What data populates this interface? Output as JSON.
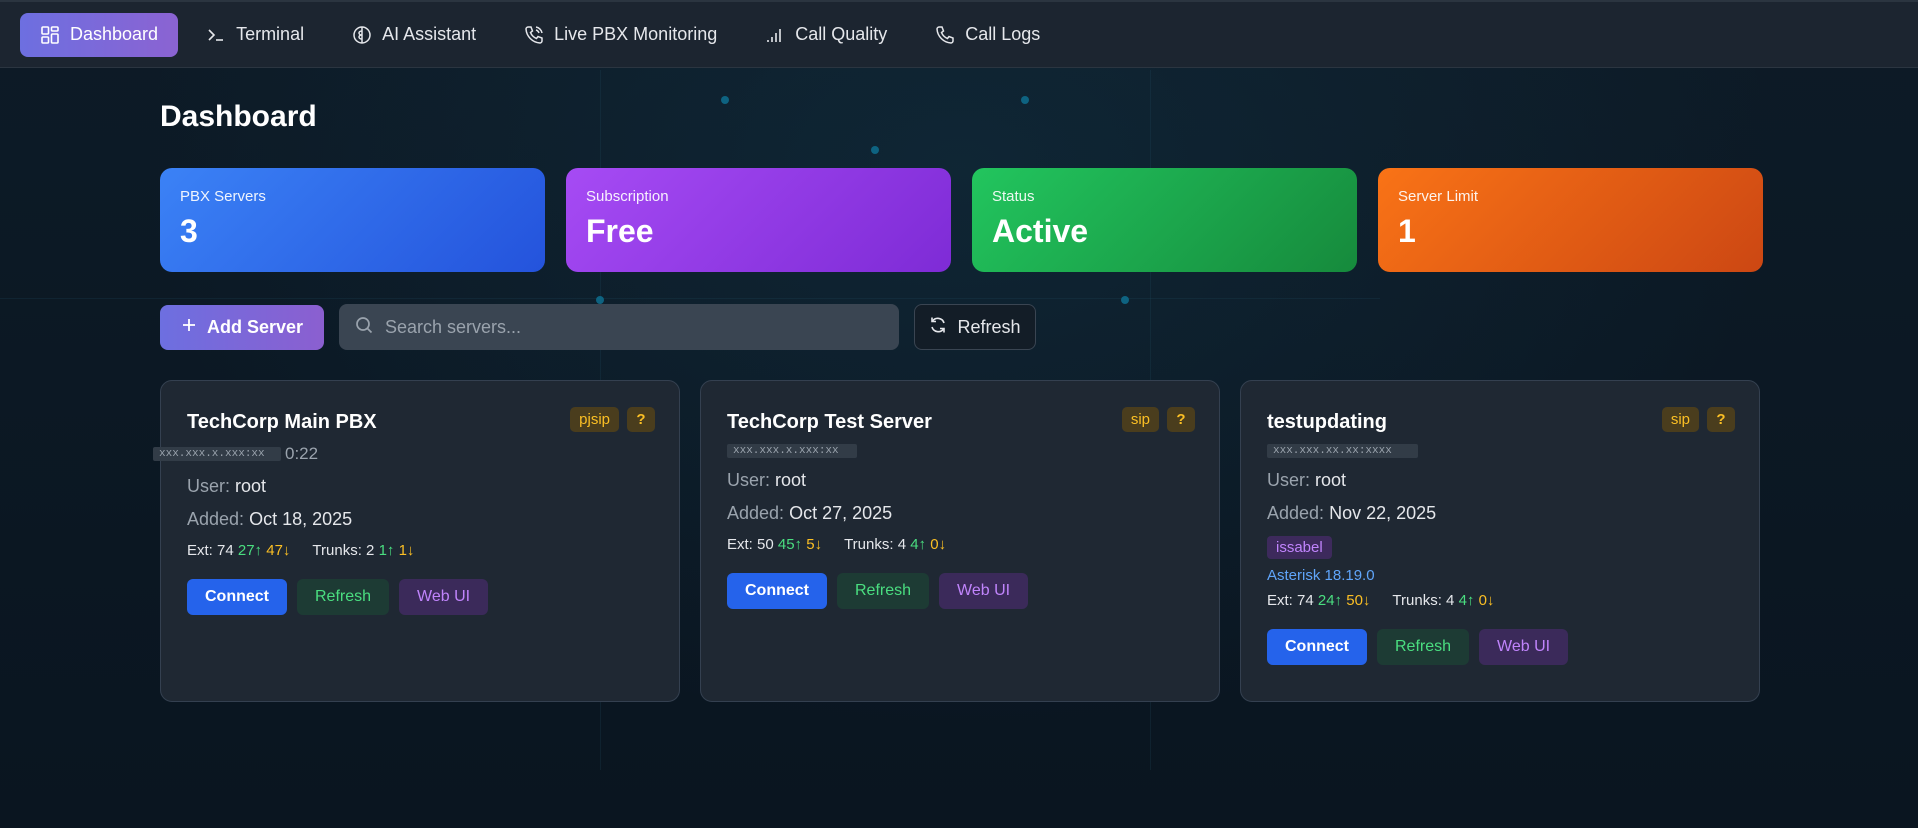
{
  "nav": {
    "items": [
      {
        "label": "Dashboard",
        "icon": "dashboard-grid-icon",
        "active": true
      },
      {
        "label": "Terminal",
        "icon": "terminal-icon",
        "active": false
      },
      {
        "label": "AI Assistant",
        "icon": "ai-brain-icon",
        "active": false
      },
      {
        "label": "Live PBX Monitoring",
        "icon": "phone-call-icon",
        "active": false
      },
      {
        "label": "Call Quality",
        "icon": "signal-bars-icon",
        "active": false
      },
      {
        "label": "Call Logs",
        "icon": "phone-icon",
        "active": false
      }
    ]
  },
  "page": {
    "title": "Dashboard"
  },
  "stats": [
    {
      "label": "PBX Servers",
      "value": "3",
      "color": "#3b82f6"
    },
    {
      "label": "Subscription",
      "value": "Free",
      "color": "#a64bf4"
    },
    {
      "label": "Status",
      "value": "Active",
      "color": "#22c55e"
    },
    {
      "label": "Server Limit",
      "value": "1",
      "color": "#f97316"
    }
  ],
  "toolbar": {
    "add_label": "Add Server",
    "search_placeholder": "Search servers...",
    "refresh_label": "Refresh"
  },
  "servers": [
    {
      "name": "TechCorp Main PBX",
      "protocol": "pjsip",
      "help": "?",
      "host_masked": "xxx.xxx.x.xxx:xx",
      "host_suffix": "0:22",
      "user_key": "User:",
      "user": "root",
      "added_key": "Added:",
      "added": "Oct 18, 2025",
      "ext_label": "Ext: 74",
      "ext_up": "27↑",
      "ext_down": "47↓",
      "trunks_label": "Trunks: 2",
      "trunks_up": "1↑",
      "trunks_down": "1↓",
      "connect": "Connect",
      "refresh": "Refresh",
      "webui": "Web UI"
    },
    {
      "name": "TechCorp Test Server",
      "protocol": "sip",
      "help": "?",
      "host_masked": "xxx.xxx.x.xxx:xx",
      "user_key": "User:",
      "user": "root",
      "added_key": "Added:",
      "added": "Oct 27, 2025",
      "ext_label": "Ext: 50",
      "ext_up": "45↑",
      "ext_down": "5↓",
      "trunks_label": "Trunks: 4",
      "trunks_up": "4↑",
      "trunks_down": "0↓",
      "connect": "Connect",
      "refresh": "Refresh",
      "webui": "Web UI"
    },
    {
      "name": "testupdating",
      "protocol": "sip",
      "help": "?",
      "host_masked": "xxx.xxx.xx.xx:xxxx",
      "user_key": "User:",
      "user": "root",
      "added_key": "Added:",
      "added": "Nov 22, 2025",
      "os": "issabel",
      "asterisk": "Asterisk 18.19.0",
      "ext_label": "Ext: 74",
      "ext_up": "24↑",
      "ext_down": "50↓",
      "trunks_label": "Trunks: 4",
      "trunks_up": "4↑",
      "trunks_down": "0↓",
      "connect": "Connect",
      "refresh": "Refresh",
      "webui": "Web UI"
    }
  ]
}
